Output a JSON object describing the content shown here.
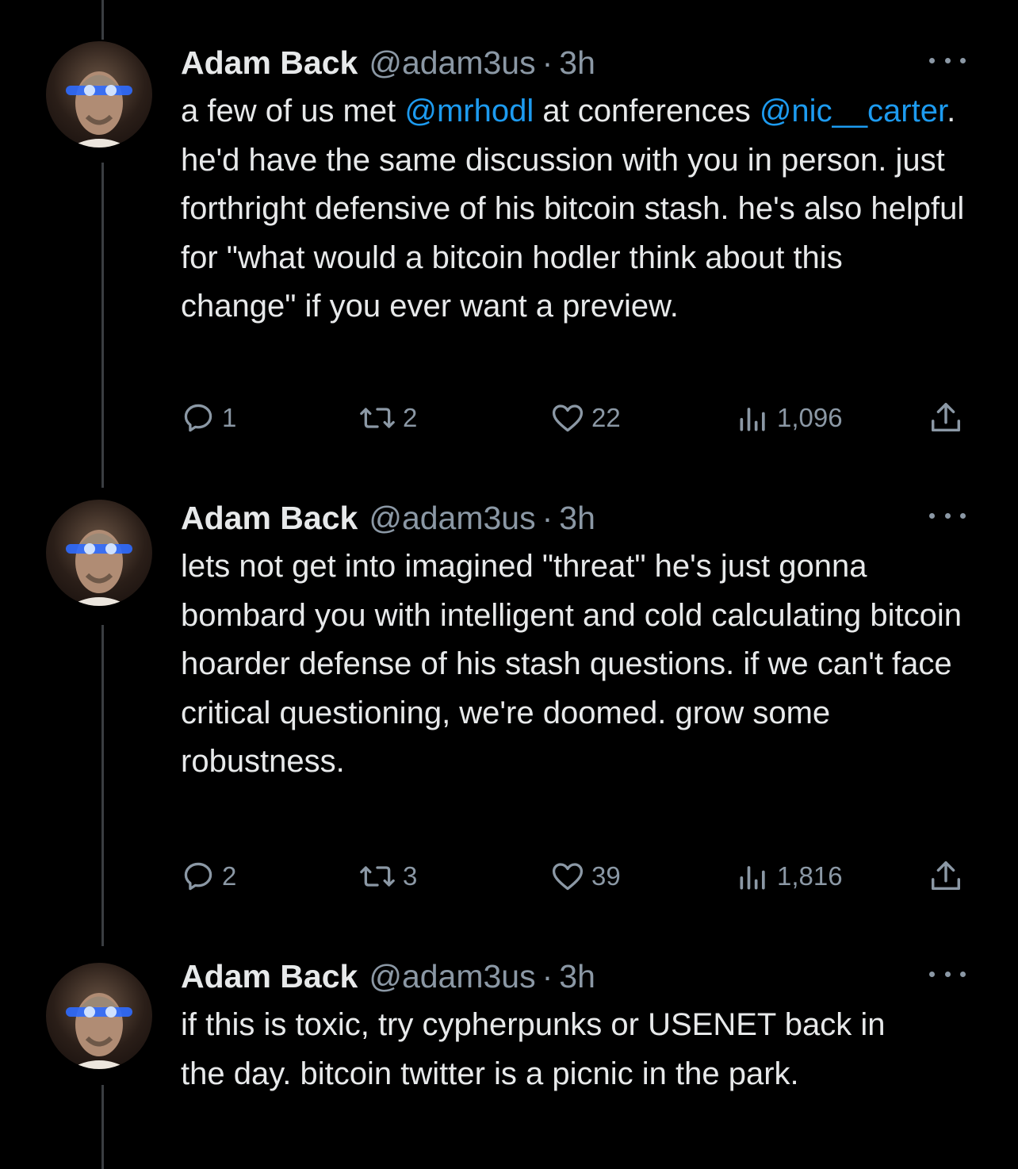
{
  "tweets": [
    {
      "author": "Adam Back",
      "handle": "@adam3us",
      "separator": "·",
      "time": "3h",
      "text_parts": [
        {
          "text": "a few of us met ",
          "type": "text"
        },
        {
          "text": "@mrhodl",
          "type": "mention"
        },
        {
          "text": " at conferences ",
          "type": "text"
        },
        {
          "text": "@nic__carter",
          "type": "mention"
        },
        {
          "text": ". he'd have the same discussion with you in person. just forthright defensive of his bitcoin stash. he's also helpful for \"what would a bitcoin hodler think about this change\" if you ever want a preview.",
          "type": "text"
        }
      ],
      "replies": "1",
      "retweets": "2",
      "likes": "22",
      "views": "1,096"
    },
    {
      "author": "Adam Back",
      "handle": "@adam3us",
      "separator": "·",
      "time": "3h",
      "text_parts": [
        {
          "text": "lets not get into imagined \"threat\" he's just gonna bombard you with intelligent and cold calculating bitcoin hoarder defense of his stash questions. if we can't face critical questioning, we're doomed. grow some robustness.",
          "type": "text"
        }
      ],
      "replies": "2",
      "retweets": "3",
      "likes": "39",
      "views": "1,816"
    },
    {
      "author": "Adam Back",
      "handle": "@adam3us",
      "separator": "·",
      "time": "3h",
      "text_parts": [
        {
          "text": "if this is toxic, try cypherpunks or USENET back in the day. bitcoin twitter is a picnic in the park.",
          "type": "text"
        }
      ]
    }
  ],
  "icons": {
    "more": "more-horizontal-icon",
    "reply": "speech-bubble-icon",
    "retweet": "retweet-arrows-icon",
    "like": "heart-icon",
    "views": "bar-chart-icon",
    "share": "share-upload-icon"
  },
  "colors": {
    "background": "#000000",
    "text": "#e7e9ea",
    "secondary": "#8b98a5",
    "mention": "#1d9bf0",
    "thread_line": "#3a3d41"
  }
}
